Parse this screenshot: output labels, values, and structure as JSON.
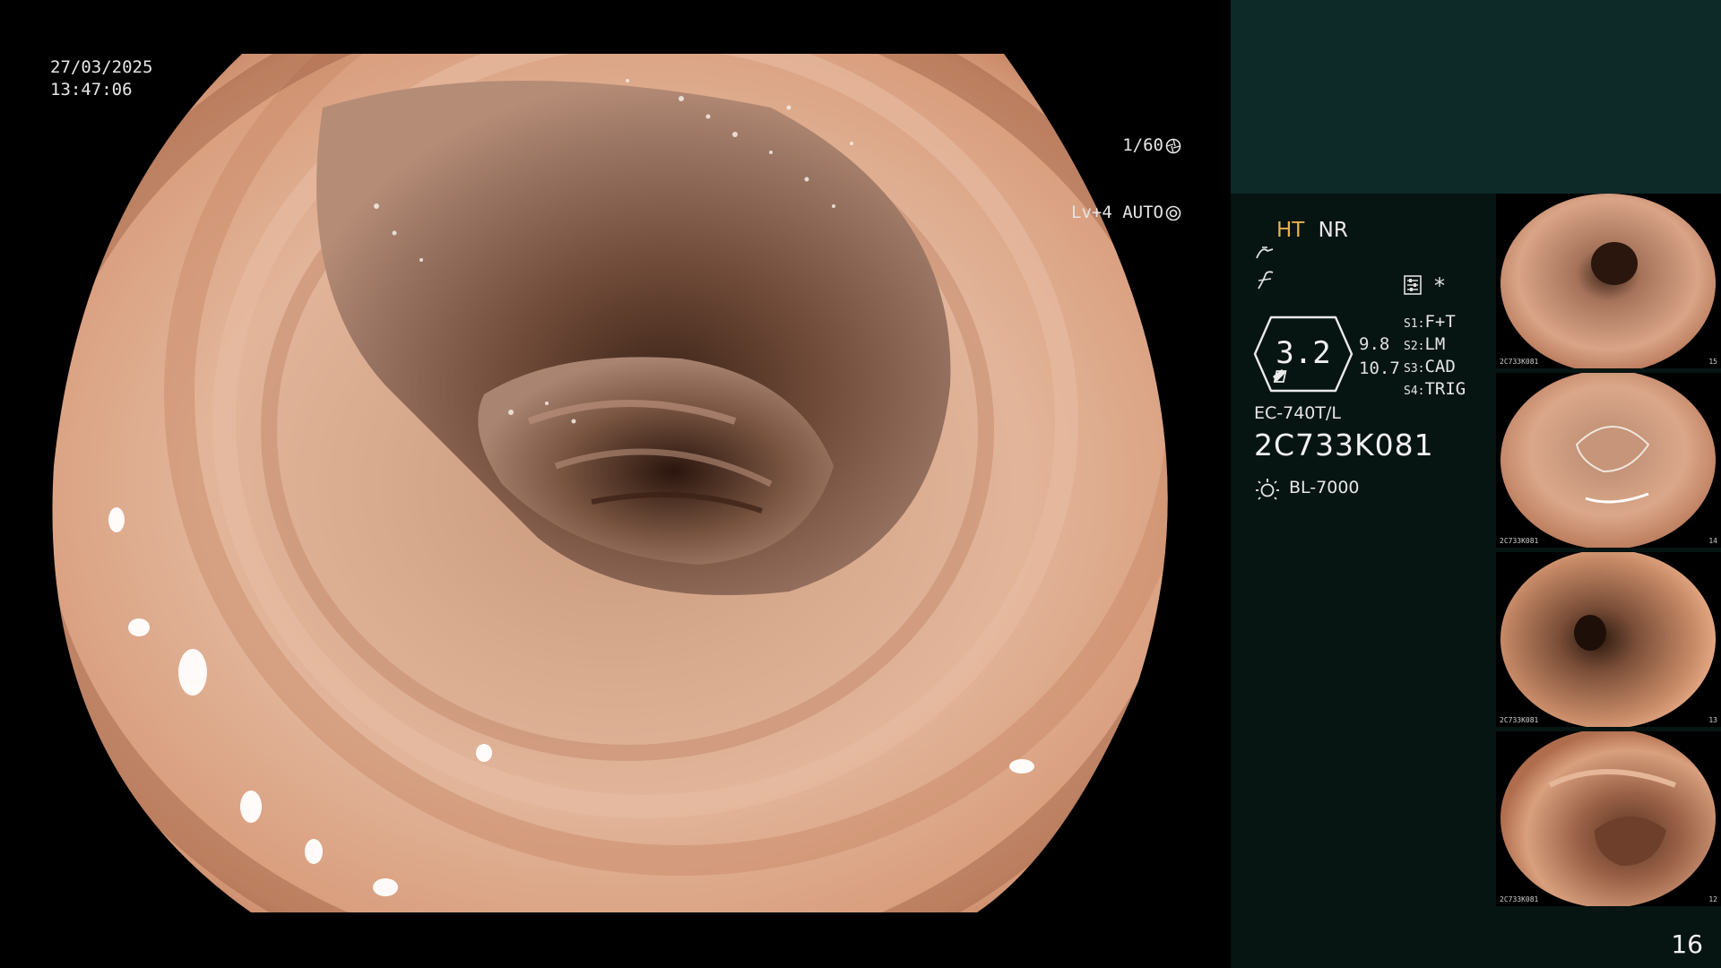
{
  "overlay": {
    "date": "27/03/2025",
    "time": "13:47:06",
    "shutter": "1/60",
    "level": "Lv+4 AUTO"
  },
  "panel": {
    "mode_ht": "HT",
    "mode_nr": "NR",
    "zoom": "3.2",
    "measure_1": "9.8",
    "measure_2": "10.7",
    "switches": [
      {
        "key": "S1:",
        "value": "F+T"
      },
      {
        "key": "S2:",
        "value": "LM"
      },
      {
        "key": "S3:",
        "value": "CAD"
      },
      {
        "key": "S4:",
        "value": "TRIG"
      }
    ],
    "model": "EC-740T/L",
    "serial": "2C733K081",
    "light_source": "BL-7000",
    "asterisk": "*",
    "page_count": "16"
  },
  "thumbnails": [
    {
      "label": "2C733K081",
      "num": "15"
    },
    {
      "label": "2C733K081",
      "num": "14"
    },
    {
      "label": "2C733K081",
      "num": "13"
    },
    {
      "label": "2C733K081",
      "num": "12"
    }
  ],
  "colors": {
    "highlight": "#e8b24a",
    "panel_top": "#0e2a28",
    "panel_bg": "#061412"
  },
  "icons": [
    "shutter-icon",
    "auto-iris-icon",
    "filter-icon",
    "enhance-icon",
    "settings-icon",
    "light-source-icon"
  ]
}
